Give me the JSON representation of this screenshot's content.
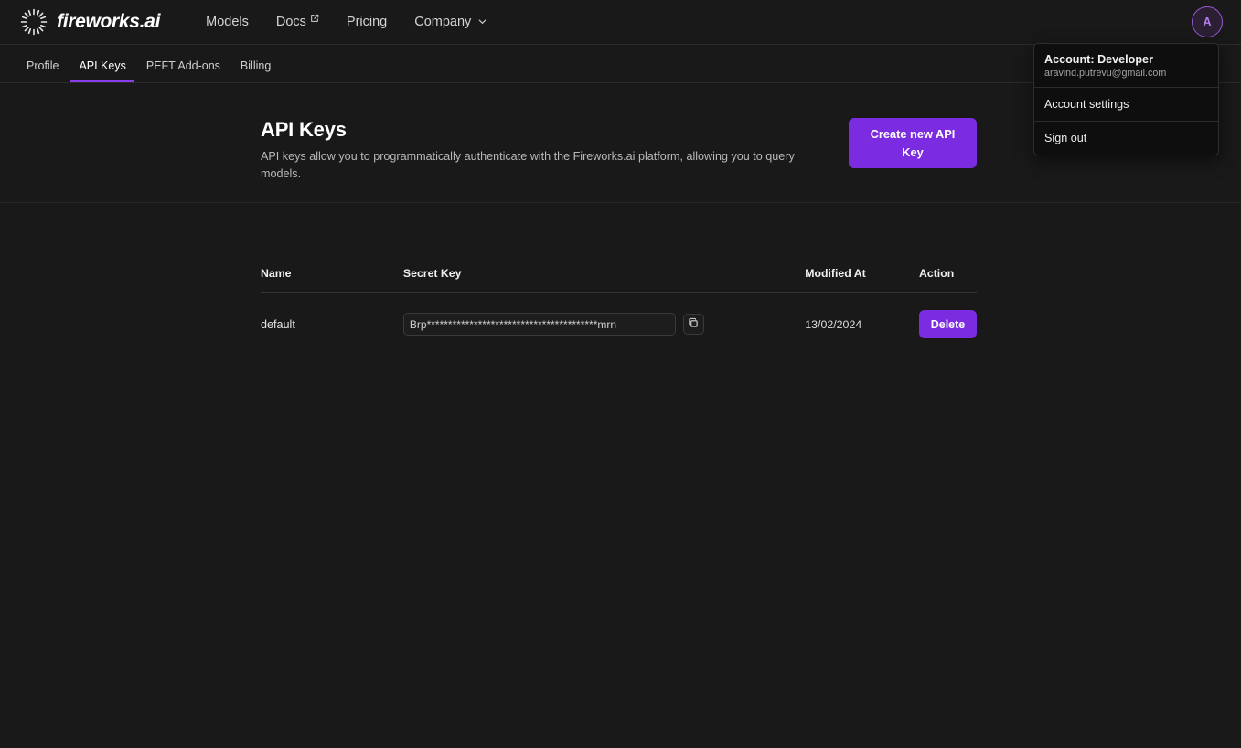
{
  "brand": {
    "name": "fireworks.ai",
    "logo_icon": "firework-burst-icon"
  },
  "nav": {
    "links": [
      {
        "label": "Models",
        "icon": null
      },
      {
        "label": "Docs",
        "icon": "external-link-icon"
      },
      {
        "label": "Pricing",
        "icon": null
      },
      {
        "label": "Company",
        "icon": "chevron-down-icon"
      }
    ],
    "avatar_initial": "A"
  },
  "tabs": [
    {
      "label": "Profile",
      "active": false
    },
    {
      "label": "API Keys",
      "active": true
    },
    {
      "label": "PEFT Add-ons",
      "active": false
    },
    {
      "label": "Billing",
      "active": false
    }
  ],
  "hero": {
    "title": "API Keys",
    "description": "API keys allow you to programmatically authenticate with the Fireworks.ai platform, allowing you to query models.",
    "create_button": "Create new API Key"
  },
  "table": {
    "columns": [
      "Name",
      "Secret Key",
      "Modified At",
      "Action"
    ],
    "rows": [
      {
        "name": "default",
        "secret_key": "Brp****************************************mrn",
        "copy_icon": "copy-icon",
        "modified_at": "13/02/2024",
        "action_label": "Delete"
      }
    ]
  },
  "account_menu": {
    "account_title": "Account: Developer",
    "email": "aravind.putrevu@gmail.com",
    "items": [
      {
        "label": "Account settings"
      },
      {
        "label": "Sign out"
      }
    ]
  },
  "colors": {
    "accent_purple": "#7b2ce0",
    "tab_underline": "#8b3dee",
    "page_bg": "#191919",
    "menu_bg": "#0e0e0e",
    "avatar_ring": "#9558d4"
  }
}
